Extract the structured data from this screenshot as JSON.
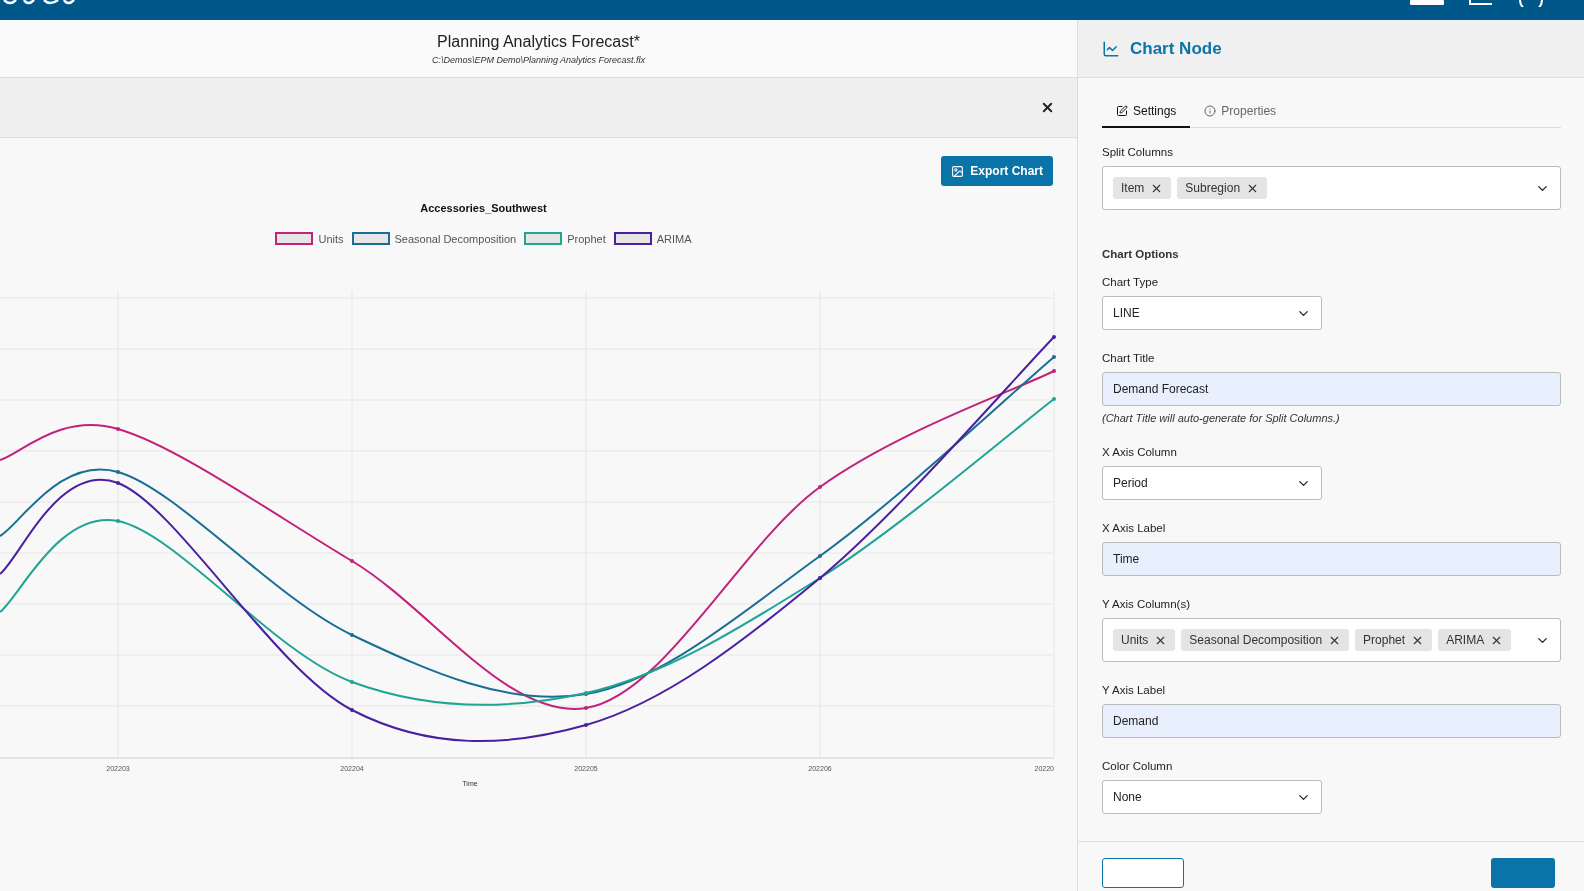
{
  "document": {
    "title": "Planning Analytics Forecast*",
    "path": "C:\\Demos\\EPM Demo\\Planning Analytics Forecast.flx"
  },
  "chart_panel": {
    "export_button": "Export Chart",
    "chart": {
      "title": "Accessories_Southwest",
      "legend": [
        {
          "name": "Units",
          "color": "#c2227a"
        },
        {
          "name": "Seasonal Decomposition",
          "color": "#1a6e96"
        },
        {
          "name": "Prophet",
          "color": "#1fa594"
        },
        {
          "name": "ARIMA",
          "color": "#4a1fa0"
        }
      ],
      "x_labels": [
        "202203",
        "202204",
        "202205",
        "202206",
        "20220"
      ],
      "xlabel": "Time"
    }
  },
  "side_panel": {
    "title": "Chart Node",
    "tabs": [
      {
        "label": "Settings",
        "selected": true
      },
      {
        "label": "Properties",
        "selected": false
      }
    ],
    "fields": [
      {
        "kind": "multiselect",
        "label": "Split Columns",
        "tags": [
          "Item",
          "Subregion"
        ]
      },
      {
        "kind": "heading",
        "label": "Chart Options"
      },
      {
        "kind": "select",
        "label": "Chart Type",
        "value": "LINE"
      },
      {
        "kind": "text",
        "label": "Chart Title",
        "value": "Demand Forecast",
        "note": "(Chart Title will auto-generate for Split Columns.)"
      },
      {
        "kind": "select",
        "label": "X Axis Column",
        "value": "Period"
      },
      {
        "kind": "text",
        "label": "X Axis Label",
        "value": "Time"
      },
      {
        "kind": "multiselect",
        "label": "Y Axis Column(s)",
        "tags": [
          "Units",
          "Seasonal Decomposition",
          "Prophet",
          "ARIMA"
        ]
      },
      {
        "kind": "text",
        "label": "Y Axis Label",
        "value": "Demand"
      },
      {
        "kind": "select",
        "label": "Color Column",
        "value": "None"
      }
    ]
  }
}
